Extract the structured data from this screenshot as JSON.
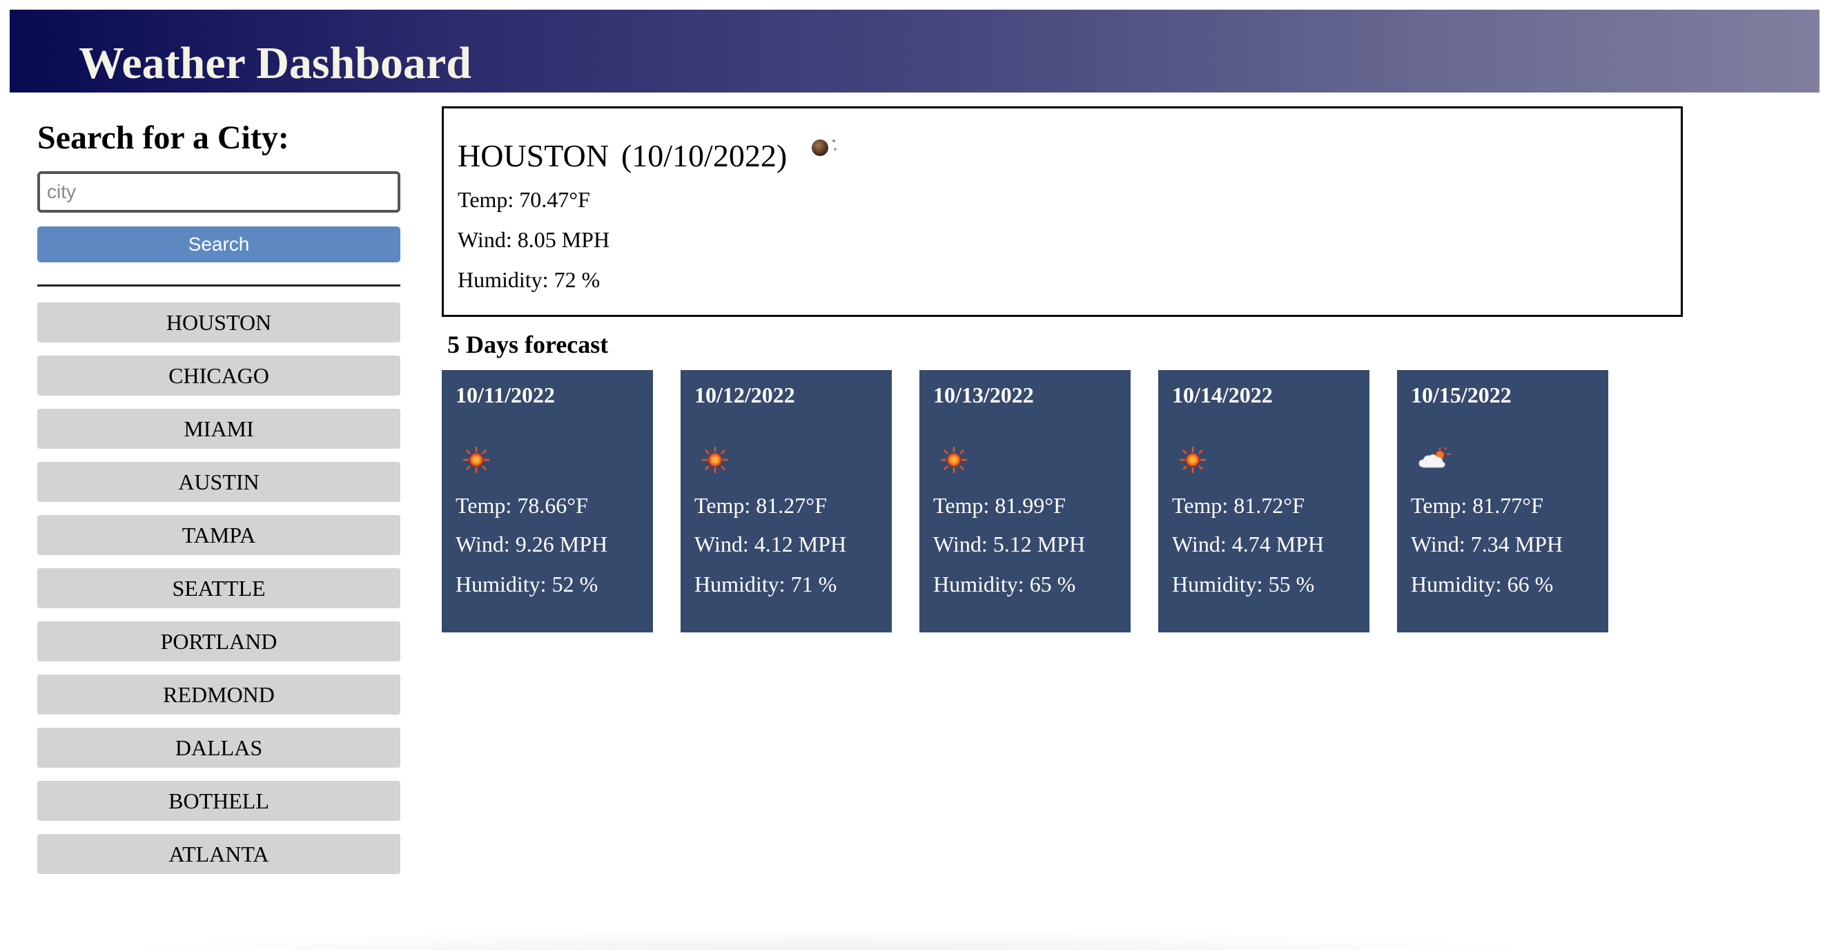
{
  "header": {
    "title": "Weather Dashboard"
  },
  "sidebar": {
    "heading": "Search for a City:",
    "search": {
      "placeholder": "city",
      "value": ""
    },
    "search_button_label": "Search",
    "history": [
      "HOUSTON",
      "CHICAGO",
      "MIAMI",
      "AUSTIN",
      "TAMPA",
      "SEATTLE",
      "PORTLAND",
      "REDMOND",
      "DALLAS",
      "BOTHELL",
      "ATLANTA"
    ]
  },
  "current": {
    "city": "HOUSTON",
    "date": "(10/10/2022)",
    "icon": "moon-icon",
    "temp": "Temp: 70.47°F",
    "wind": "Wind: 8.05 MPH",
    "humidity": "Humidity: 72 %"
  },
  "forecast": {
    "title": "5 Days forecast",
    "days": [
      {
        "date": "10/11/2022",
        "icon": "sun-icon",
        "temp": "Temp: 78.66°F",
        "wind": "Wind: 9.26 MPH",
        "humidity": "Humidity: 52 %"
      },
      {
        "date": "10/12/2022",
        "icon": "sun-icon",
        "temp": "Temp: 81.27°F",
        "wind": "Wind: 4.12 MPH",
        "humidity": "Humidity: 71 %"
      },
      {
        "date": "10/13/2022",
        "icon": "sun-icon",
        "temp": "Temp: 81.99°F",
        "wind": "Wind: 5.12 MPH",
        "humidity": "Humidity: 65 %"
      },
      {
        "date": "10/14/2022",
        "icon": "sun-icon",
        "temp": "Temp: 81.72°F",
        "wind": "Wind: 4.74 MPH",
        "humidity": "Humidity: 55 %"
      },
      {
        "date": "10/15/2022",
        "icon": "cloud-sun-icon",
        "temp": "Temp: 81.77°F",
        "wind": "Wind: 7.34 MPH",
        "humidity": "Humidity: 66 %"
      }
    ]
  },
  "colors": {
    "header_gradient_start": "#080a52",
    "header_gradient_end": "#807f9f",
    "search_button": "#5d88c1",
    "history_button": "#d3d3d3",
    "forecast_card": "#364a6d"
  }
}
